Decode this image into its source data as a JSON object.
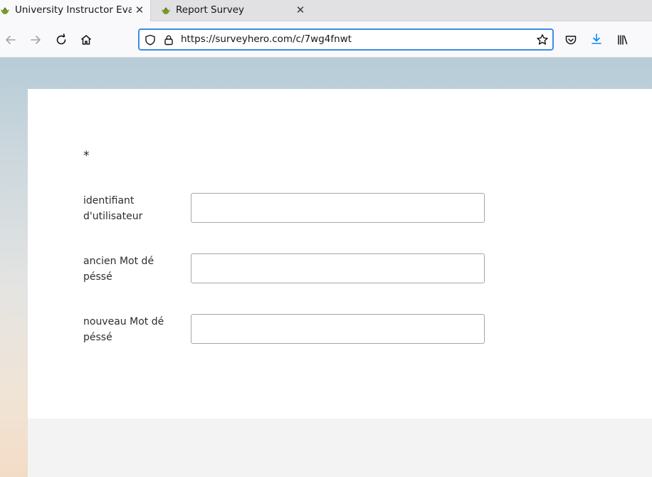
{
  "browser": {
    "tabs": [
      {
        "title": "University Instructor Evaluati",
        "active": true
      },
      {
        "title": "Report Survey",
        "active": false
      }
    ],
    "close_glyph": "✕",
    "url": "https://surveyhero.com/c/7wg4fnwt",
    "icons": [
      "back-arrow-icon",
      "forward-arrow-icon",
      "reload-icon",
      "home-icon",
      "shield-icon",
      "lock-icon",
      "bookmark-star-icon",
      "pocket-icon",
      "download-icon",
      "library-icon"
    ]
  },
  "form": {
    "required_marker": "*",
    "fields": [
      {
        "label": "identifiant d'utilisateur",
        "value": ""
      },
      {
        "label": "ancien Mot dé péssé",
        "value": ""
      },
      {
        "label": "nouveau Mot dé péssé",
        "value": ""
      }
    ]
  },
  "colors": {
    "accent": "#3d8be6",
    "download": "#0a84ff"
  }
}
